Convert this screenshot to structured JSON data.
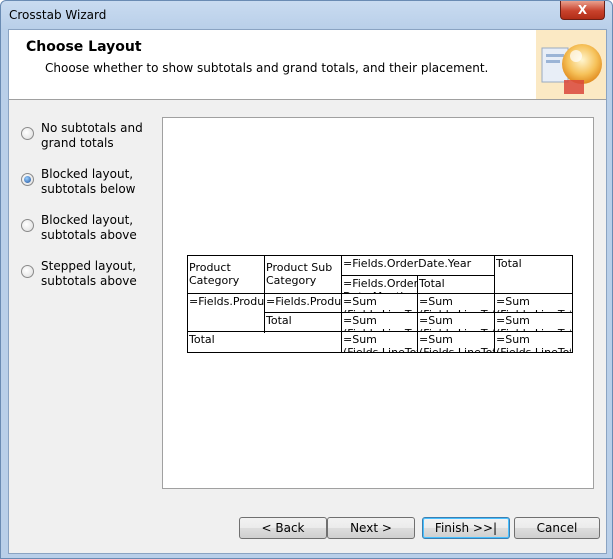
{
  "window": {
    "title": "Crosstab Wizard",
    "close": "X"
  },
  "header": {
    "title": "Choose Layout",
    "subtitle": "Choose whether to show subtotals and grand totals, and their placement."
  },
  "options": [
    {
      "label": "No subtotals and grand totals",
      "selected": false
    },
    {
      "label": "Blocked layout, subtotals below",
      "selected": true
    },
    {
      "label": "Blocked layout, subtotals above",
      "selected": false
    },
    {
      "label": "Stepped layout, subtotals above",
      "selected": false
    }
  ],
  "crosstab": {
    "product_category": "Product Category",
    "product_sub_category": "Product Sub Category",
    "order_year": "=Fields.OrderDate.Year",
    "col_total": "Total",
    "order_month": "=Fields.Order Date.Month",
    "year_total": "Total",
    "row_group_1": "=Fields.ProductCategory",
    "row_group_2": "=Fields.ProductSubCategory",
    "sub_total": "Total",
    "grand_total": "Total",
    "sum_cell": "=Sum (Fields.LineTotal)"
  },
  "buttons": {
    "back": "< Back",
    "next": "Next >",
    "finish": "Finish >>|",
    "cancel": "Cancel"
  }
}
